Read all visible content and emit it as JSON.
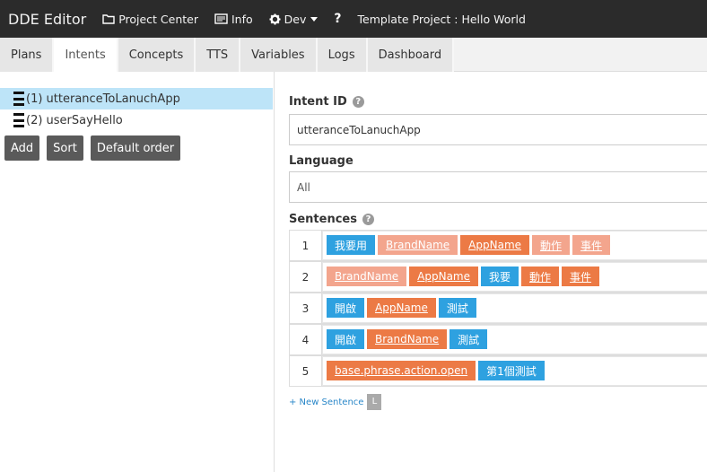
{
  "app": {
    "title": "DDE Editor",
    "nav": {
      "project_center": "Project Center",
      "info": "Info",
      "dev": "Dev",
      "help": "?",
      "project": "Template Project : Hello World"
    }
  },
  "tabs": [
    "Plans",
    "Intents",
    "Concepts",
    "TTS",
    "Variables",
    "Logs",
    "Dashboard"
  ],
  "active_tab": "Intents",
  "intents": [
    {
      "label": "(1) utteranceToLanuchApp",
      "selected": true
    },
    {
      "label": "(2) userSayHello",
      "selected": false
    }
  ],
  "left_buttons": {
    "add": "Add",
    "sort": "Sort",
    "default_order": "Default order"
  },
  "form": {
    "intent_id_label": "Intent ID",
    "intent_id_value": "utteranceToLanuchApp",
    "language_label": "Language",
    "language_value": "All",
    "sentences_label": "Sentences",
    "help_icon": "?"
  },
  "sentences": [
    {
      "num": "1",
      "chips": [
        {
          "text": "我要用",
          "kind": "text"
        },
        {
          "text": "BrandName",
          "kind": "optional-concept"
        },
        {
          "text": "AppName",
          "kind": "concept"
        },
        {
          "text": "動作",
          "kind": "optional-concept"
        },
        {
          "text": "事件",
          "kind": "optional-concept"
        }
      ]
    },
    {
      "num": "2",
      "chips": [
        {
          "text": "BrandName",
          "kind": "optional-concept"
        },
        {
          "text": "AppName",
          "kind": "concept"
        },
        {
          "text": "我要",
          "kind": "text"
        },
        {
          "text": "動作",
          "kind": "concept"
        },
        {
          "text": "事件",
          "kind": "concept"
        }
      ]
    },
    {
      "num": "3",
      "chips": [
        {
          "text": "開啟",
          "kind": "text"
        },
        {
          "text": "AppName",
          "kind": "concept"
        },
        {
          "text": "測試",
          "kind": "text"
        }
      ]
    },
    {
      "num": "4",
      "chips": [
        {
          "text": "開啟",
          "kind": "text"
        },
        {
          "text": "BrandName",
          "kind": "concept"
        },
        {
          "text": "測試",
          "kind": "text"
        }
      ]
    },
    {
      "num": "5",
      "chips": [
        {
          "text": "base.phrase.action.open",
          "kind": "concept"
        },
        {
          "text": "第1個測試",
          "kind": "text"
        }
      ]
    }
  ],
  "new_sentence": {
    "label": "+ New Sentence",
    "shortcut": "L"
  },
  "colors": {
    "topbar": "#2b2b2b",
    "selected": "#bde4f8",
    "text_chip": "#2ea1e0",
    "concept_chip": "#ec7a45",
    "optional_chip": "#f3a58d"
  }
}
